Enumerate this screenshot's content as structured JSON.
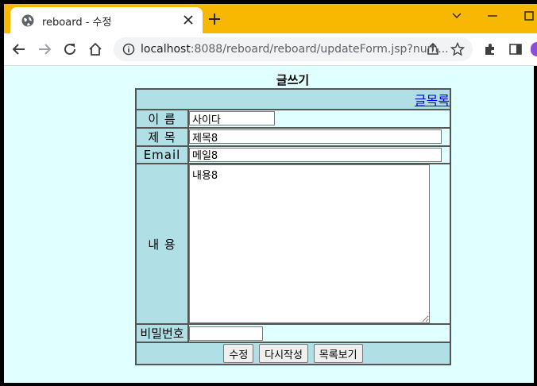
{
  "browser": {
    "tab_title": "reboard - 수정",
    "url_host": "localhost",
    "url_rest": ":8088/reboard/reboard/updateForm.jsp?num...",
    "accent": "#f8b700"
  },
  "page": {
    "heading": "글쓰기",
    "list_link": "글목록",
    "fields": {
      "name_label": "이 름",
      "name_value": "사이다",
      "subject_label": "제 목",
      "subject_value": "제목8",
      "email_label": "Email",
      "email_value": "메일8",
      "content_label": "내 용",
      "content_value": "내용8",
      "password_label": "비밀번호",
      "password_value": ""
    },
    "buttons": {
      "submit": "수정",
      "reset": "다시작성",
      "list": "목록보기"
    },
    "colors": {
      "page_bg": "#e0ffff",
      "label_bg": "#b0e0e6"
    }
  }
}
